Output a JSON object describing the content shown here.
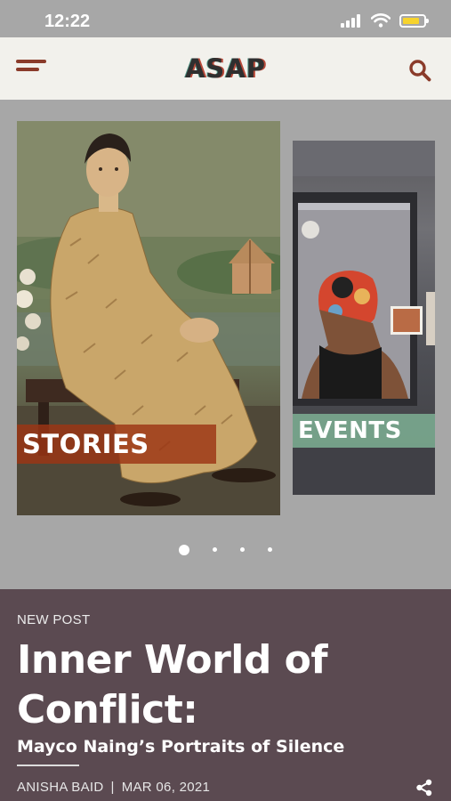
{
  "status_bar": {
    "time": "12:22",
    "icons": [
      "signal-icon",
      "wifi-icon",
      "battery-icon"
    ],
    "battery_color": "#f6d32d"
  },
  "header": {
    "logo": "ASAP",
    "menu_icon": "hamburger-menu-icon",
    "search_icon": "search-icon",
    "accent_color": "#8a3b2a"
  },
  "carousel": {
    "cards": [
      {
        "label": "STORIES",
        "label_bg": "#9c3414"
      },
      {
        "label": "EVENTS",
        "label_bg": "#7eb094"
      }
    ],
    "page_count": 4,
    "active_page": 1
  },
  "post": {
    "tag": "NEW POST",
    "title_line1": "Inner World of",
    "title_line2": "Conflict:",
    "subtitle": "Mayco Naing’s Portraits of Silence",
    "author": "ANISHA BAID",
    "separator": "|",
    "date": "MAR 06, 2021",
    "share_icon": "share-icon",
    "bg_color": "#5b4a51"
  }
}
